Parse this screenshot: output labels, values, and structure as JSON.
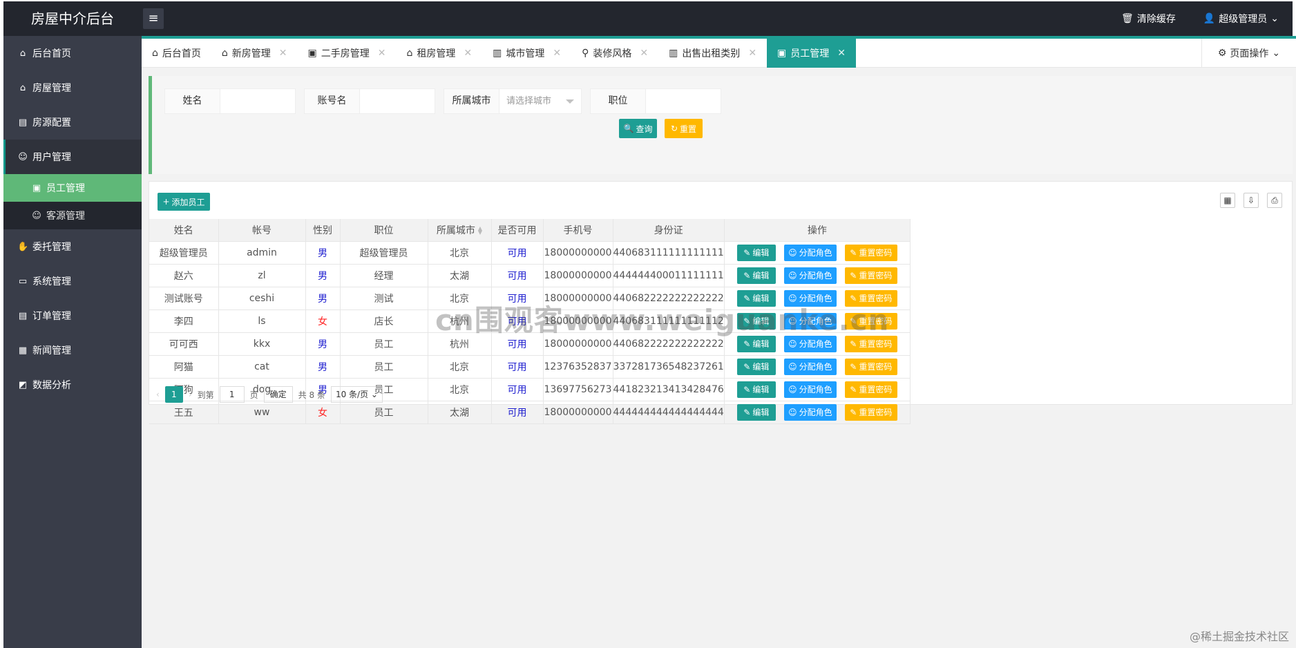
{
  "header": {
    "brand": "房屋中介后台",
    "menu_toggle": "≡",
    "clear_cache": "清除缓存",
    "user": "超级管理员"
  },
  "sidebar": {
    "items": [
      {
        "label": "后台首页"
      },
      {
        "label": "房屋管理"
      },
      {
        "label": "房源配置"
      },
      {
        "label": "用户管理"
      },
      {
        "label": "委托管理"
      },
      {
        "label": "系统管理"
      },
      {
        "label": "订单管理"
      },
      {
        "label": "新闻管理"
      },
      {
        "label": "数据分析"
      }
    ],
    "sub_items": [
      {
        "label": "员工管理"
      },
      {
        "label": "客源管理"
      }
    ]
  },
  "tabs": [
    {
      "label": "后台首页"
    },
    {
      "label": "新房管理"
    },
    {
      "label": "二手房管理"
    },
    {
      "label": "租房管理"
    },
    {
      "label": "城市管理"
    },
    {
      "label": "装修风格"
    },
    {
      "label": "出售出租类别"
    },
    {
      "label": "员工管理"
    }
  ],
  "page_ops": "页面操作",
  "search": {
    "name_label": "姓名",
    "account_label": "账号名",
    "city_label": "所属城市",
    "city_placeholder": "请选择城市",
    "position_label": "职位",
    "query_btn": "查询",
    "reset_btn": "重置"
  },
  "add_btn": "添加员工",
  "table": {
    "headers": [
      "姓名",
      "帐号",
      "性别",
      "职位",
      "所属城市",
      "是否可用",
      "手机号",
      "身份证",
      "操作"
    ],
    "rows": [
      [
        "超级管理员",
        "admin",
        "男",
        "超级管理员",
        "北京",
        "可用",
        "18000000000",
        "440683111111111111"
      ],
      [
        "赵六",
        "zl",
        "男",
        "经理",
        "太湖",
        "可用",
        "18000000000",
        "444444400011111111"
      ],
      [
        "测试账号",
        "ceshi",
        "男",
        "测试",
        "北京",
        "可用",
        "18000000000",
        "440682222222222222"
      ],
      [
        "李四",
        "ls",
        "女",
        "店长",
        "杭州",
        "可用",
        "18000000000",
        "440683111111111112"
      ],
      [
        "可可西",
        "kkx",
        "男",
        "员工",
        "杭州",
        "可用",
        "18000000000",
        "440682222222222222"
      ],
      [
        "阿猫",
        "cat",
        "男",
        "员工",
        "北京",
        "可用",
        "12376352837",
        "337281736548237261"
      ],
      [
        "阿狗",
        "dog",
        "男",
        "员工",
        "北京",
        "可用",
        "13697756273",
        "441823213413428476"
      ],
      [
        "王五",
        "ww",
        "女",
        "员工",
        "太湖",
        "可用",
        "18000000000",
        "444444444444444444"
      ]
    ],
    "op_edit": "编辑",
    "op_role": "分配角色",
    "op_reset": "重置密码"
  },
  "pager": {
    "current": "1",
    "goto_label": "到第",
    "goto_value": "1",
    "page_unit": "页",
    "confirm": "确定",
    "total": "共 8 条",
    "per_page": "10 条/页"
  },
  "watermark": "cn围观客www.weiguanke.cn",
  "corner_mark": "@稀土掘金技术社区",
  "colors": {
    "accent": "#1e9e94",
    "sidebar": "#393d49",
    "active_sub": "#5fb878",
    "yellow": "#ffb800",
    "blue": "#1e9fff"
  }
}
